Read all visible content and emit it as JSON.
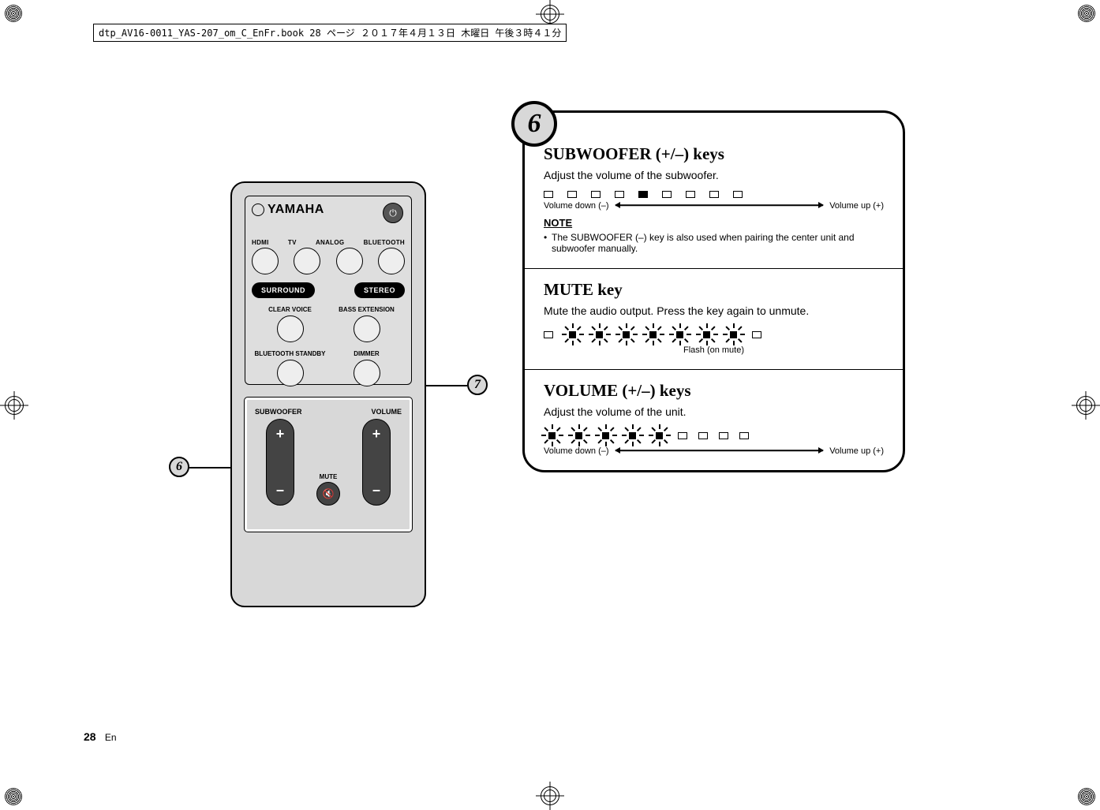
{
  "meta_header": "dtp_AV16-0011_YAS-207_om_C_EnFr.book  28 ページ  ２０１７年４月１３日  木曜日  午後３時４１分",
  "footer": {
    "page": "28",
    "lang": "En"
  },
  "remote": {
    "brand": "YAMAHA",
    "row1_labels": [
      "HDMI",
      "TV",
      "ANALOG",
      "BLUETOOTH"
    ],
    "pills": {
      "surround": "SURROUND",
      "stereo": "STEREO"
    },
    "row2_labels": {
      "left": "CLEAR VOICE",
      "right": "BASS EXTENSION"
    },
    "row3_labels": {
      "left": "BLUETOOTH STANDBY",
      "right": "DIMMER"
    },
    "sec6_labels": {
      "sub": "SUBWOOFER",
      "vol": "VOLUME",
      "mute": "MUTE"
    }
  },
  "callouts": {
    "six": "6",
    "seven": "7"
  },
  "panel": {
    "s1_title": "SUBWOOFER (+/–) keys",
    "s1_desc": "Adjust the volume of the subwoofer.",
    "vol_down": "Volume down (–)",
    "vol_up": "Volume up (+)",
    "note_h": "NOTE",
    "note_li": "The SUBWOOFER (–) key is also used when pairing the center unit and subwoofer manually.",
    "s2_title": "MUTE key",
    "s2_desc": "Mute the audio output. Press the key again to unmute.",
    "flash_lbl": "Flash (on mute)",
    "s3_title": "VOLUME (+/–) keys",
    "s3_desc": "Adjust the volume of the unit."
  }
}
